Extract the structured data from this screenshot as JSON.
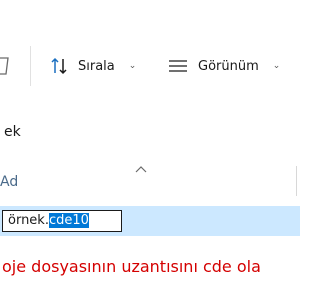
{
  "toolbar": {
    "sort_label": "Sırala",
    "view_label": "Görünüm"
  },
  "address": {
    "text": "ek"
  },
  "column_header": {
    "name_label": "Ad"
  },
  "file_row": {
    "rename_base": "örnek.",
    "rename_ext_selected": "cde10"
  },
  "caption": "oje dosyasının uzantısını cde ola",
  "colors": {
    "selection_row": "#cce8ff",
    "selection_text": "#0078d7",
    "caption_red": "#d40000",
    "sort_icon_blue": "#1a6fc0"
  }
}
